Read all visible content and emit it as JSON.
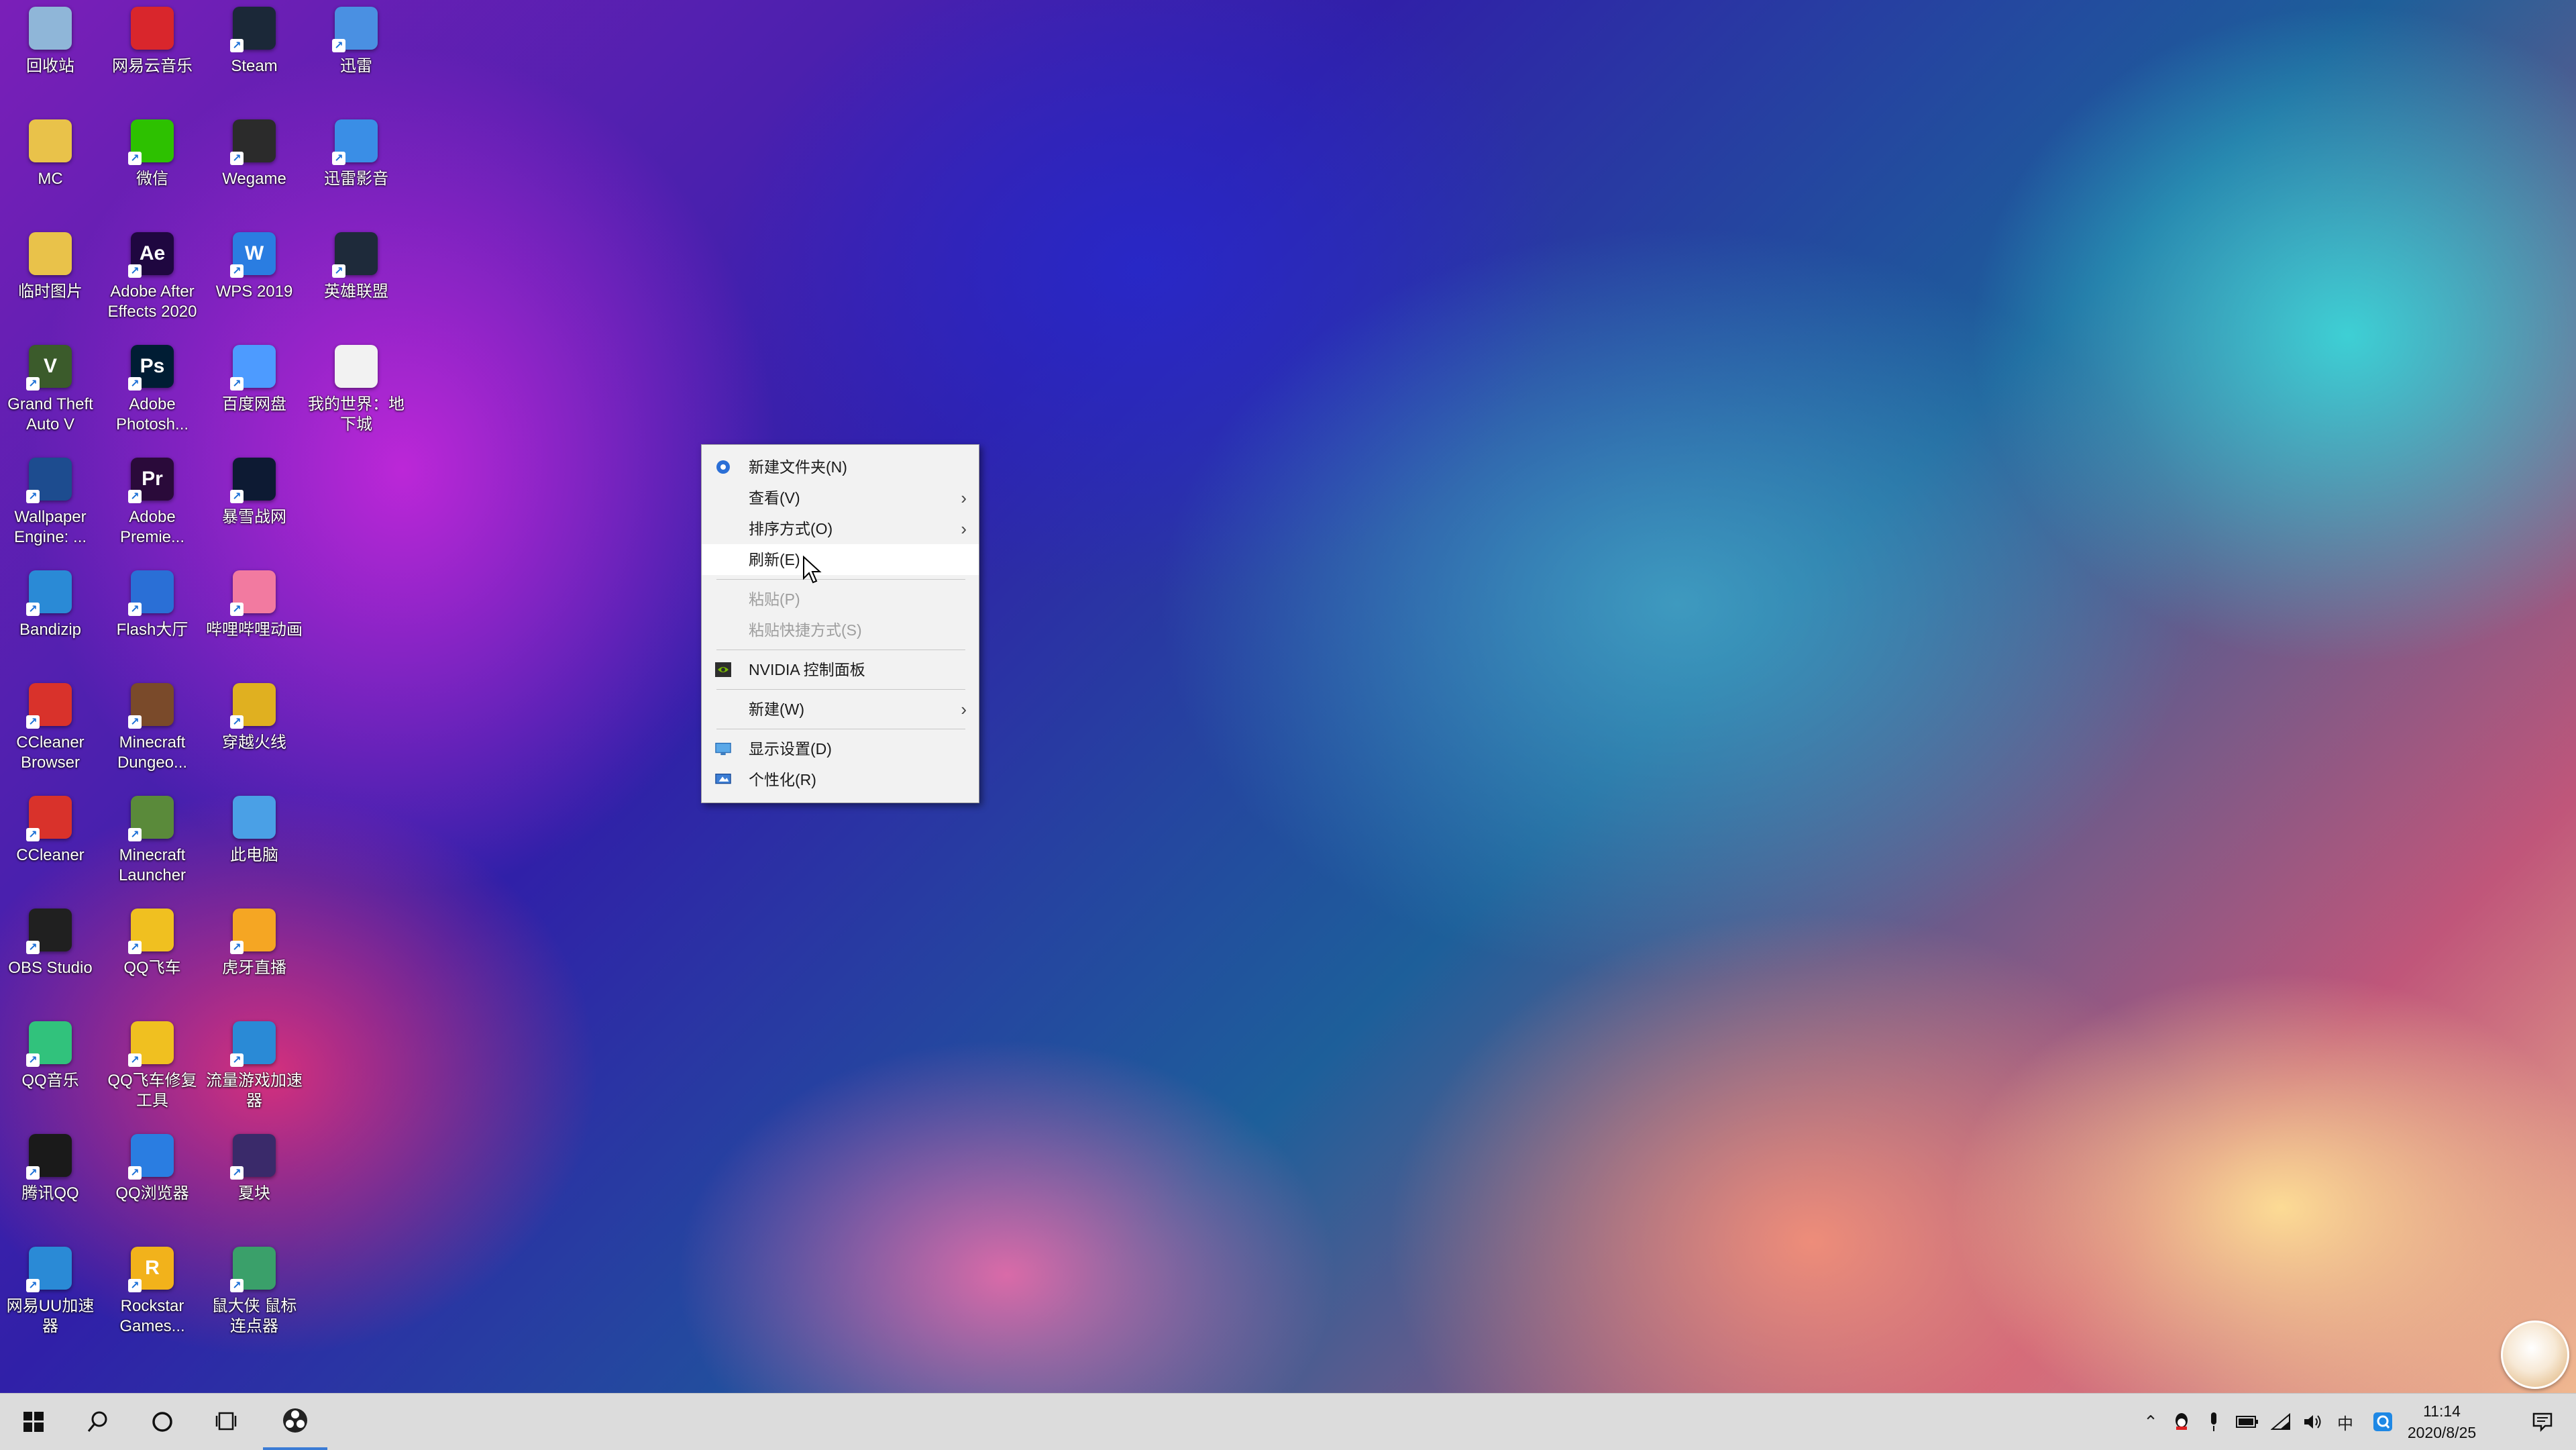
{
  "desktop": {
    "icons": [
      {
        "label": "回收站",
        "icon": "recycle-bin-icon",
        "color": "#8fb6d8"
      },
      {
        "label": "网易云音乐",
        "icon": "netease-music-icon",
        "color": "#d9262c"
      },
      {
        "label": "Steam",
        "icon": "steam-icon",
        "color": "#1b2838"
      },
      {
        "label": "迅雷",
        "icon": "xunlei-icon",
        "color": "#4a90e2"
      },
      {
        "label": "MC",
        "icon": "folder-icon",
        "color": "#e9c24a"
      },
      {
        "label": "微信",
        "icon": "wechat-icon",
        "color": "#2dc100"
      },
      {
        "label": "Wegame",
        "icon": "wegame-icon",
        "color": "#2b2b2b"
      },
      {
        "label": "迅雷影音",
        "icon": "xunlei-player-icon",
        "color": "#3a8ee6"
      },
      {
        "label": "临时图片",
        "icon": "folder-icon",
        "color": "#e9c24a"
      },
      {
        "label": "Adobe After Effects 2020",
        "icon": "after-effects-icon",
        "color": "#1f0740",
        "glyph": "Ae"
      },
      {
        "label": "WPS 2019",
        "icon": "wps-icon",
        "color": "#2a7de1",
        "glyph": "W"
      },
      {
        "label": "英雄联盟",
        "icon": "league-of-legends-icon",
        "color": "#1e2a3a"
      },
      {
        "label": "Grand Theft Auto V",
        "icon": "gta-v-icon",
        "color": "#3b5b2b",
        "glyph": "V"
      },
      {
        "label": "Adobe Photosh...",
        "icon": "photoshop-icon",
        "color": "#001d34",
        "glyph": "Ps"
      },
      {
        "label": "百度网盘",
        "icon": "baidu-netdisk-icon",
        "color": "#4d9bff"
      },
      {
        "label": "我的世界：地下城",
        "icon": "document-icon",
        "color": "#f2f2f2"
      },
      {
        "label": "Wallpaper Engine: ...",
        "icon": "wallpaper-engine-icon",
        "color": "#1d4c8f"
      },
      {
        "label": "Adobe Premie...",
        "icon": "premiere-icon",
        "color": "#2a0a3a",
        "glyph": "Pr"
      },
      {
        "label": "暴雪战网",
        "icon": "battle-net-icon",
        "color": "#0d1a33"
      },
      {
        "label": "Bandizip",
        "icon": "bandizip-icon",
        "color": "#2a8ad6"
      },
      {
        "label": "Flash大厅",
        "icon": "flash-icon",
        "color": "#2a6fd6"
      },
      {
        "label": "哔哩哔哩动画",
        "icon": "bilibili-icon",
        "color": "#f27aa0"
      },
      {
        "label": "CCleaner Browser",
        "icon": "ccleaner-browser-icon",
        "color": "#d9322b"
      },
      {
        "label": "Minecraft Dungeo...",
        "icon": "minecraft-dungeons-icon",
        "color": "#7a4a2a"
      },
      {
        "label": "穿越火线",
        "icon": "crossfire-icon",
        "color": "#e0b020"
      },
      {
        "label": "CCleaner",
        "icon": "ccleaner-icon",
        "color": "#d9322b"
      },
      {
        "label": "Minecraft Launcher",
        "icon": "minecraft-launcher-icon",
        "color": "#5a8a3a"
      },
      {
        "label": "此电脑",
        "icon": "this-pc-icon",
        "color": "#4aa0e6"
      },
      {
        "label": "OBS Studio",
        "icon": "obs-icon",
        "color": "#202020"
      },
      {
        "label": "QQ飞车",
        "icon": "qq-speed-icon",
        "color": "#f0c020"
      },
      {
        "label": "虎牙直播",
        "icon": "huya-icon",
        "color": "#f5a623"
      },
      {
        "label": "QQ音乐",
        "icon": "qq-music-icon",
        "color": "#31c27c"
      },
      {
        "label": "QQ飞车修复工具",
        "icon": "qq-speed-repair-icon",
        "color": "#f0c020"
      },
      {
        "label": "流量游戏加速器",
        "icon": "game-accelerator-icon",
        "color": "#2a8ad6"
      },
      {
        "label": "腾讯QQ",
        "icon": "qq-icon",
        "color": "#1a1a1a"
      },
      {
        "label": "QQ浏览器",
        "icon": "qq-browser-icon",
        "color": "#2a7de1"
      },
      {
        "label": "夏块",
        "icon": "app-icon",
        "color": "#3a2a6a"
      },
      {
        "label": "网易UU加速器",
        "icon": "uu-accelerator-icon",
        "color": "#2a8ad6"
      },
      {
        "label": "Rockstar Games...",
        "icon": "rockstar-icon",
        "color": "#f2b21b",
        "glyph": "R"
      },
      {
        "label": "鼠大侠 鼠标连点器",
        "icon": "mouse-clicker-icon",
        "color": "#3aa06a"
      }
    ]
  },
  "context_menu": {
    "items": [
      {
        "type": "item",
        "label": "新建文件夹(N)",
        "icon": "new-folder-icon",
        "has_sub": false,
        "disabled": false,
        "hover": false
      },
      {
        "type": "item",
        "label": "查看(V)",
        "icon": "",
        "has_sub": true,
        "disabled": false,
        "hover": false
      },
      {
        "type": "item",
        "label": "排序方式(O)",
        "icon": "",
        "has_sub": true,
        "disabled": false,
        "hover": false
      },
      {
        "type": "item",
        "label": "刷新(E)",
        "icon": "",
        "has_sub": false,
        "disabled": false,
        "hover": true
      },
      {
        "type": "sep"
      },
      {
        "type": "item",
        "label": "粘贴(P)",
        "icon": "",
        "has_sub": false,
        "disabled": true,
        "hover": false
      },
      {
        "type": "item",
        "label": "粘贴快捷方式(S)",
        "icon": "",
        "has_sub": false,
        "disabled": true,
        "hover": false
      },
      {
        "type": "sep"
      },
      {
        "type": "item",
        "label": "NVIDIA 控制面板",
        "icon": "nvidia-icon",
        "has_sub": false,
        "disabled": false,
        "hover": false
      },
      {
        "type": "sep"
      },
      {
        "type": "item",
        "label": "新建(W)",
        "icon": "",
        "has_sub": true,
        "disabled": false,
        "hover": false
      },
      {
        "type": "sep"
      },
      {
        "type": "item",
        "label": "显示设置(D)",
        "icon": "display-settings-icon",
        "has_sub": false,
        "disabled": false,
        "hover": false
      },
      {
        "type": "item",
        "label": "个性化(R)",
        "icon": "personalize-icon",
        "has_sub": false,
        "disabled": false,
        "hover": false
      }
    ],
    "submenu_arrow": "›"
  },
  "taskbar": {
    "buttons": [
      {
        "name": "start-button",
        "icon": "windows-icon"
      },
      {
        "name": "search-button",
        "icon": "search-icon"
      },
      {
        "name": "cortana-button",
        "icon": "cortana-circle-icon"
      },
      {
        "name": "task-view-button",
        "icon": "task-view-icon"
      },
      {
        "name": "obs-taskbar-button",
        "icon": "obs-icon"
      }
    ],
    "tray": {
      "chevron": "⌃",
      "icons": [
        "qq-tray-icon",
        "microphone-icon",
        "battery-icon",
        "network-icon",
        "volume-icon",
        "ime-icon",
        "qq-tray-blue-icon"
      ],
      "ime_label": "中"
    },
    "clock": {
      "time": "11:14",
      "date": "2020/8/25"
    },
    "notification_icon": "notification-icon"
  }
}
